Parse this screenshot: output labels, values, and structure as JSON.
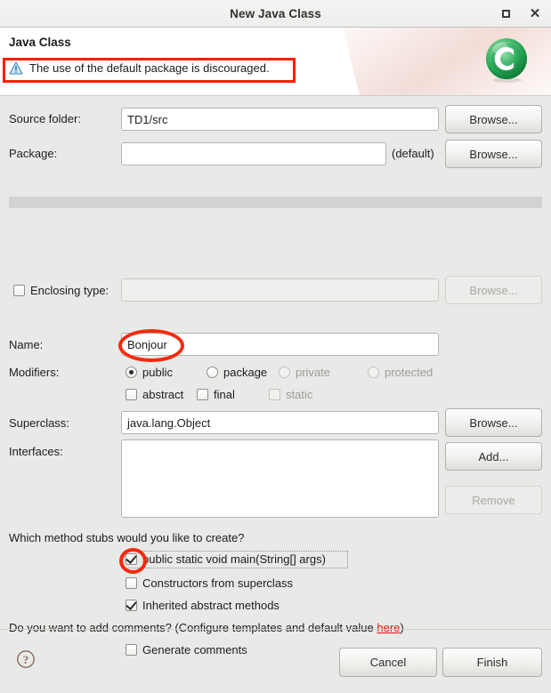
{
  "window": {
    "title": "New Java Class",
    "maximize_icon": "maximize-icon",
    "close_icon": "close-icon",
    "close_glyph": "✕"
  },
  "banner": {
    "title": "Java Class",
    "message": "The use of the default package is discouraged.",
    "message_icon": "warning-triangle-icon",
    "logo_icon": "eclipse-class-logo-icon",
    "highlight_color": "#fb1d05"
  },
  "form": {
    "source_folder": {
      "label": "Source folder:",
      "value": "TD1/src",
      "placeholder": "",
      "browse_label": "Browse..."
    },
    "package": {
      "label": "Package:",
      "value": "",
      "placeholder": "",
      "suffix": "(default)",
      "browse_label": "Browse..."
    },
    "enclosing_type": {
      "label": "Enclosing type:",
      "checked": false,
      "value": "",
      "placeholder": "",
      "browse_label": "Browse...",
      "enabled": false
    },
    "name": {
      "label": "Name:",
      "value": "Bonjour",
      "placeholder": ""
    },
    "modifiers": {
      "label": "Modifiers:",
      "access": [
        {
          "label": "public",
          "selected": true,
          "enabled": true
        },
        {
          "label": "package",
          "selected": false,
          "enabled": true
        },
        {
          "label": "private",
          "selected": false,
          "enabled": false
        },
        {
          "label": "protected",
          "selected": false,
          "enabled": false
        }
      ],
      "flags": [
        {
          "label": "abstract",
          "checked": false,
          "enabled": true
        },
        {
          "label": "final",
          "checked": false,
          "enabled": true
        },
        {
          "label": "static",
          "checked": false,
          "enabled": false
        }
      ]
    },
    "superclass": {
      "label": "Superclass:",
      "value": "java.lang.Object",
      "placeholder": "",
      "browse_label": "Browse..."
    },
    "interfaces": {
      "label": "Interfaces:",
      "value": "",
      "add_label": "Add...",
      "remove_label": "Remove",
      "remove_enabled": false
    },
    "method_stubs": {
      "question": "Which method stubs would you like to create?",
      "options": [
        {
          "label": "public static void main(String[] args)",
          "checked": true,
          "focused": true
        },
        {
          "label": "Constructors from superclass",
          "checked": false,
          "focused": false
        },
        {
          "label": "Inherited abstract methods",
          "checked": true,
          "focused": false
        }
      ]
    },
    "comments": {
      "question_prefix": "Do you want to add comments? (Configure templates and default value ",
      "link_label": "here",
      "question_suffix": ")",
      "checkbox_label": "Generate comments",
      "checked": false
    }
  },
  "footer": {
    "help_icon": "help-question-icon",
    "cancel_label": "Cancel",
    "finish_label": "Finish"
  },
  "annotations": {
    "color": "#f42a0c",
    "name_ellipse": "red-ellipse-around-name-field",
    "main_checkbox_circle": "red-circle-around-main-checkbox",
    "warning_box": "red-box-around-warning-message"
  }
}
